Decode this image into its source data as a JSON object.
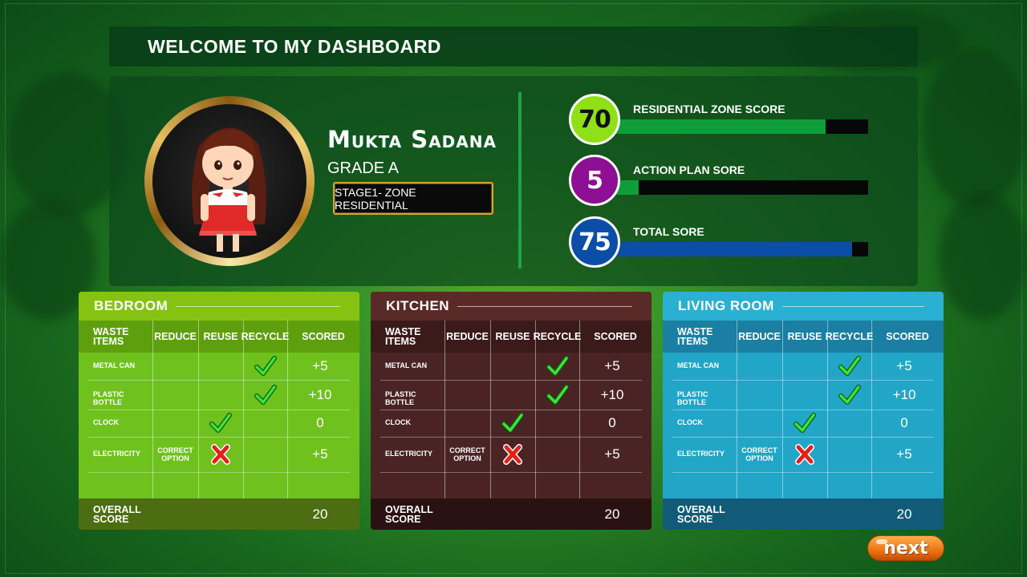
{
  "header": {
    "title": "WELCOME TO MY DASHBOARD"
  },
  "profile": {
    "name": "Mukta Sadana",
    "grade": "GRADE A",
    "stage": "STAGE1- ZONE RESIDENTIAL"
  },
  "scores": [
    {
      "label": "RESIDENTIAL ZONE SCORE",
      "value": "70",
      "fill_fraction": 0.84,
      "color": "#0f9d3a",
      "circle_color": "#8fe017",
      "text_color": "#111111"
    },
    {
      "label": "ACTION PLAN SORE",
      "value": "5",
      "fill_fraction": 0.14,
      "color": "#0f9d3a",
      "circle_color": "#8c0f94",
      "text_color": "#ffffff"
    },
    {
      "label": "TOTAL SORE",
      "value": "75",
      "fill_fraction": 0.94,
      "color": "#0b4ea8",
      "circle_color": "#0b4ea8",
      "text_color": "#ffffff"
    }
  ],
  "table_headers": {
    "waste_items": "WASTE ITEMS",
    "reduce": "REDUCE",
    "reuse": "REUSE",
    "recycle": "RECYCLE",
    "scored": "SCORED"
  },
  "rooms": [
    {
      "title": "BEDROOM",
      "rows": [
        {
          "item": "METAL CAN",
          "mark": "check",
          "mark_col": "recycle",
          "score": "+5"
        },
        {
          "item": "PLASTIC BOTTLE",
          "mark": "check",
          "mark_col": "recycle",
          "score": "+10"
        },
        {
          "item": "CLOCK",
          "mark": "check",
          "mark_col": "reuse",
          "score": "0"
        },
        {
          "item": "ELECTRICITY",
          "note": "CORRECT OPTION",
          "mark": "cross",
          "mark_col": "reuse",
          "score": "+5"
        }
      ],
      "overall_label": "OVERALL SCORE",
      "overall_score": "20",
      "colors": {
        "body": "#6fc21d",
        "header": "#86c212",
        "head_row": "#5e9f0e",
        "foot": "#4d6d12"
      }
    },
    {
      "title": "KITCHEN",
      "rows": [
        {
          "item": "METAL CAN",
          "mark": "check",
          "mark_col": "recycle",
          "score": "+5"
        },
        {
          "item": "PLASTIC BOTTLE",
          "mark": "check",
          "mark_col": "recycle",
          "score": "+10"
        },
        {
          "item": "CLOCK",
          "mark": "check",
          "mark_col": "reuse",
          "score": "0"
        },
        {
          "item": "ELECTRICITY",
          "note": "CORRECT OPTION",
          "mark": "cross",
          "mark_col": "reuse",
          "score": "+5"
        }
      ],
      "overall_label": "OVERALL SCORE",
      "overall_score": "20",
      "colors": {
        "body": "#4a2424",
        "header": "#5a2a28",
        "head_row": "#3b1a1a",
        "foot": "#2a1212"
      }
    },
    {
      "title": "LIVING ROOM",
      "rows": [
        {
          "item": "METAL CAN",
          "mark": "check",
          "mark_col": "recycle",
          "score": "+5"
        },
        {
          "item": "PLASTIC BOTTLE",
          "mark": "check",
          "mark_col": "recycle",
          "score": "+10"
        },
        {
          "item": "CLOCK",
          "mark": "check",
          "mark_col": "reuse",
          "score": "0"
        },
        {
          "item": "ELECTRICITY",
          "note": "CORRECT OPTION",
          "mark": "cross",
          "mark_col": "reuse",
          "score": "+5"
        }
      ],
      "overall_label": "OVERALL SCORE",
      "overall_score": "20",
      "colors": {
        "body": "#22a6c8",
        "header": "#2ab0d2",
        "head_row": "#1a7fa2",
        "foot": "#125b78"
      }
    }
  ],
  "next_button": {
    "label": "next",
    "color": "#e56a0c"
  }
}
